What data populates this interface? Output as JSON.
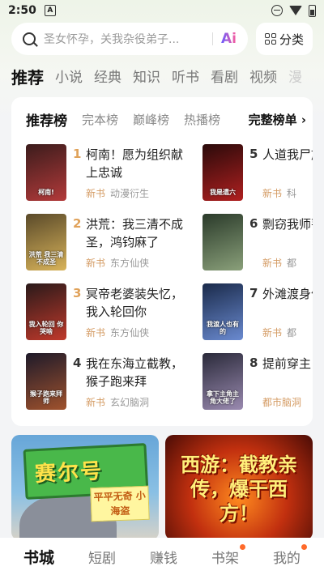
{
  "status_bar": {
    "time": "2:50",
    "notif_icon": "A"
  },
  "search": {
    "placeholder": "圣女怀孕，关我杂役弟子...",
    "ai_label": "Ai"
  },
  "category_button": {
    "label": "分类"
  },
  "channel_tabs": [
    "推荐",
    "小说",
    "经典",
    "知识",
    "听书",
    "看剧",
    "视频",
    "漫"
  ],
  "rank_tabs": [
    "推荐榜",
    "完本榜",
    "巅峰榜",
    "热播榜"
  ],
  "rank_more": "完整榜单 ›",
  "books": [
    {
      "rank": "1",
      "title": "柯南！愿为组织献上忠诚",
      "tag": "新书",
      "genre": "动漫衍生",
      "cover_text": "柯南!",
      "cover_colors": [
        "#3b1c1c",
        "#b33a3a"
      ],
      "rank_color": "#e0a25a"
    },
    {
      "rank": "2",
      "title": "洪荒：我三清不成圣，鸿钧麻了",
      "tag": "新书",
      "genre": "东方仙侠",
      "cover_text": "洪荒 我三清不成圣",
      "cover_colors": [
        "#5a4a2a",
        "#d8b35a"
      ],
      "rank_color": "#e0a25a"
    },
    {
      "rank": "3",
      "title": "冥帝老婆装失忆，我入轮回你",
      "tag": "新书",
      "genre": "东方仙侠",
      "cover_text": "我入轮回 你哭啥",
      "cover_colors": [
        "#2a1a1a",
        "#c0392b"
      ],
      "rank_color": "#e0a25a"
    },
    {
      "rank": "4",
      "title": "我在东海立截教，猴子跑来拜",
      "tag": "新书",
      "genre": "玄幻脑洞",
      "cover_text": "猴子跑来拜师",
      "cover_colors": [
        "#1e1a2a",
        "#a0522d"
      ],
      "rank_color": "#333333"
    },
    {
      "rank": "5",
      "title": "人道我尸族我",
      "tag": "新书",
      "genre": "科",
      "cover_text": "我是遗六",
      "cover_colors": [
        "#2a0a0a",
        "#b02020"
      ],
      "rank_color": "#333333"
    },
    {
      "rank": "6",
      "title": "剽窃我师菩提",
      "tag": "新书",
      "genre": "都",
      "cover_text": "",
      "cover_colors": [
        "#2a3a2a",
        "#8aa07a"
      ],
      "rank_color": "#333333"
    },
    {
      "rank": "7",
      "title": "外滩渡身份曝",
      "tag": "新书",
      "genre": "都",
      "cover_text": "我渡人也有的",
      "cover_colors": [
        "#1a2a4a",
        "#6a8ad0"
      ],
      "rank_color": "#333333"
    },
    {
      "rank": "8",
      "title": "提前穿主，主",
      "tag": "都市脑洞",
      "genre": "",
      "cover_text": "拿下主角主角大佬了",
      "cover_colors": [
        "#2a2a3a",
        "#9a8ab0"
      ],
      "rank_color": "#333333"
    }
  ],
  "banners": [
    {
      "title": "赛尔号",
      "tag": "平平无奇 小海盗"
    },
    {
      "title": "西游：截教亲传，爆干西方！"
    }
  ],
  "bottom_nav": [
    {
      "label": "书城",
      "active": true,
      "dot": false
    },
    {
      "label": "短剧",
      "active": false,
      "dot": false
    },
    {
      "label": "赚钱",
      "active": false,
      "dot": false
    },
    {
      "label": "书架",
      "active": false,
      "dot": true
    },
    {
      "label": "我的",
      "active": false,
      "dot": true
    }
  ]
}
